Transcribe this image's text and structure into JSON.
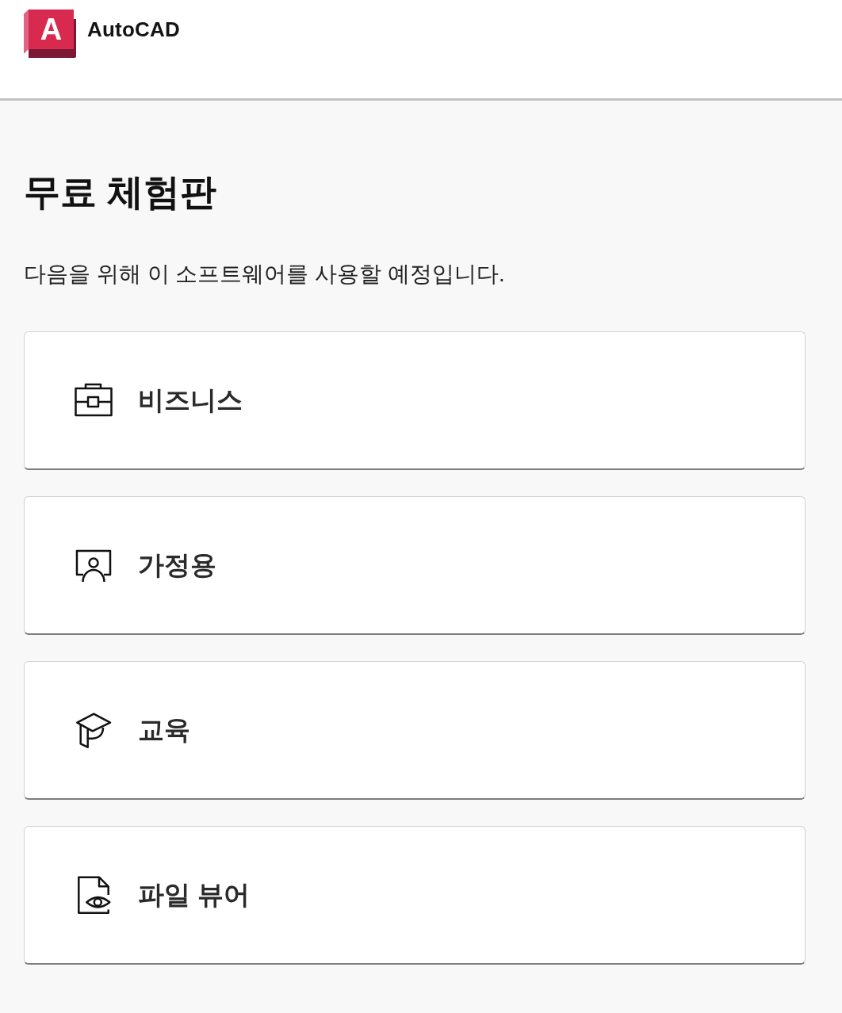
{
  "header": {
    "logo_mark": "A",
    "product_name": "AutoCAD"
  },
  "heading": "무료 체험판",
  "prompt": "다음을 위해 이 소프트웨어를 사용할 예정입니다.",
  "options": [
    {
      "kind": "business",
      "label": "비즈니스"
    },
    {
      "kind": "home",
      "label": "가정용"
    },
    {
      "kind": "education",
      "label": "교육"
    },
    {
      "kind": "file-viewer",
      "label": "파일 뷰어"
    }
  ]
}
